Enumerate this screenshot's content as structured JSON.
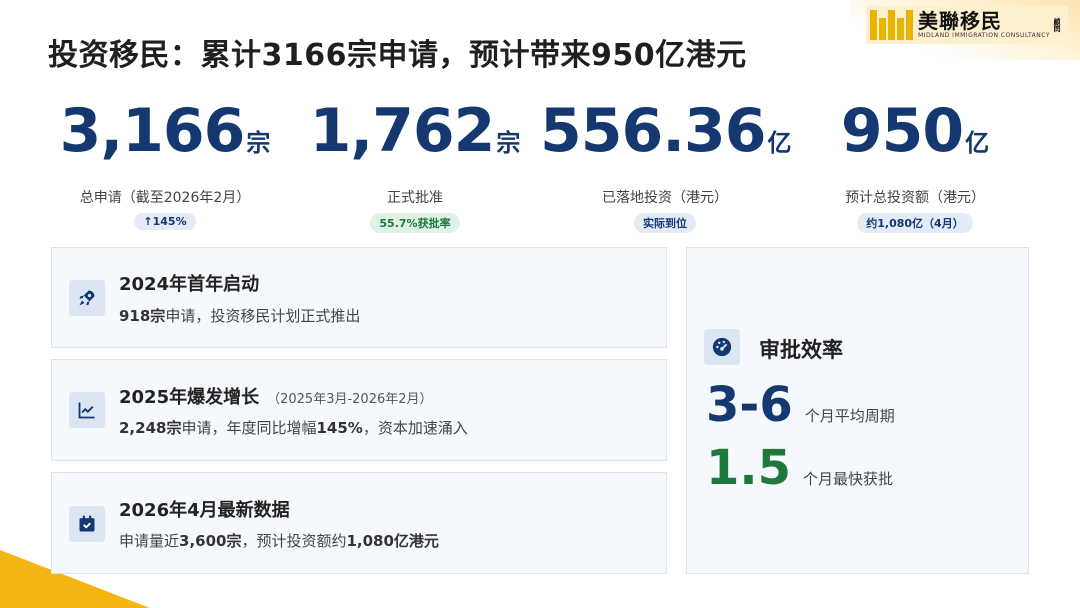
{
  "title": "投资移民：累计3166宗申请，预计带来950亿港元",
  "logo": {
    "name": "美聯移民",
    "tag": "顧問",
    "subtitle": "MIDLAND IMMIGRATION CONSULTANCY"
  },
  "stats": [
    {
      "value": "3,166",
      "unit": "宗",
      "label": "总申请（截至2026年2月）",
      "badge": "↑145%"
    },
    {
      "value": "1,762",
      "unit": "宗",
      "label": "正式批准",
      "badge": "55.7%获批率"
    },
    {
      "value": "556.36",
      "unit": "亿",
      "label": "已落地投资（港元）",
      "badge": "实际到位"
    },
    {
      "value": "950",
      "unit": "亿",
      "label": "预计总投资额（港元）",
      "badge": "约1,080亿（4月）"
    }
  ],
  "timeline": [
    {
      "icon": "rocket-icon",
      "title": "2024年首年启动",
      "note": "",
      "desc_bold": "918宗",
      "desc_rest": "申请，投资移民计划正式推出"
    },
    {
      "icon": "line-chart-icon",
      "title": "2025年爆发增长",
      "note": "（2025年3月-2026年2月）",
      "desc_bold": "2,248宗",
      "desc_mid": "申请，年度同比增幅",
      "desc_bold2": "145%",
      "desc_rest": "，资本加速涌入"
    },
    {
      "icon": "calendar-check-icon",
      "title": "2026年4月最新数据",
      "note": "",
      "desc_pre": "申请量近",
      "desc_bold": "3,600宗",
      "desc_mid": "，预计投资额约",
      "desc_bold2": "1,080亿港元"
    }
  ],
  "efficiency": {
    "title": "审批效率",
    "metrics": [
      {
        "value": "3-6",
        "label": "个月平均周期",
        "color": "#14386f"
      },
      {
        "value": "1.5",
        "label": "个月最快获批",
        "color": "#1e7a3a"
      }
    ]
  },
  "colors": {
    "navy": "#14386f",
    "green": "#1e7a3a",
    "accent_yellow": "#f5b512"
  }
}
